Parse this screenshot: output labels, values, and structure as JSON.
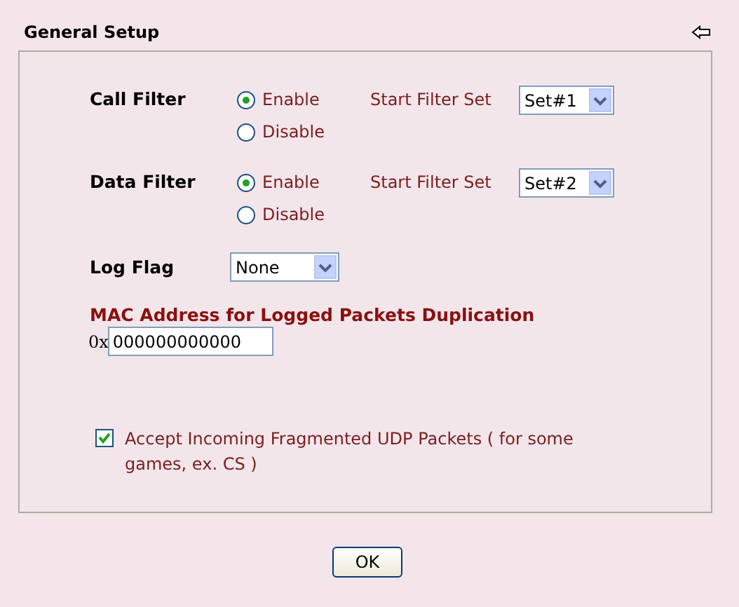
{
  "section": {
    "title": "General Setup"
  },
  "filters": [
    {
      "label": "Call Filter",
      "options": [
        {
          "label": "Enable",
          "selected": true
        },
        {
          "label": "Disable",
          "selected": false
        }
      ],
      "start_set_label": "Start Filter Set",
      "start_set_value": "Set#1"
    },
    {
      "label": "Data Filter",
      "options": [
        {
          "label": "Enable",
          "selected": true
        },
        {
          "label": "Disable",
          "selected": false
        }
      ],
      "start_set_label": "Start Filter Set",
      "start_set_value": "Set#2"
    }
  ],
  "log_flag": {
    "label": "Log Flag",
    "value": "None"
  },
  "mac": {
    "label": "MAC Address for Logged Packets Duplication",
    "prefix": "0x",
    "value": "000000000000"
  },
  "fragmented_udp": {
    "label": "Accept Incoming Fragmented UDP Packets ( for some games, ex. CS )",
    "checked": true
  },
  "buttons": [
    {
      "label": "OK"
    }
  ]
}
